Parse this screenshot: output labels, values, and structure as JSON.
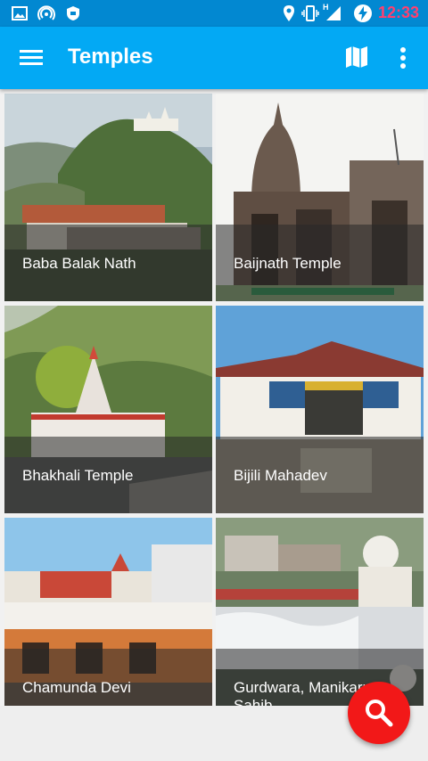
{
  "status_bar": {
    "time": "12:33",
    "icons": [
      "image-icon",
      "hotspot-icon",
      "shield-icon",
      "location-icon",
      "vibrate-icon",
      "signal-icon",
      "battery-charging-icon"
    ],
    "network_label": "H"
  },
  "app_bar": {
    "title": "Temples",
    "menu_icon": "menu-icon",
    "map_icon": "map-icon",
    "more_icon": "more-vert-icon",
    "color": "#03a9f4"
  },
  "temples": [
    {
      "name": "Baba Balak Nath"
    },
    {
      "name": "Baijnath Temple"
    },
    {
      "name": "Bhakhali Temple"
    },
    {
      "name": "Bijili Mahadev"
    },
    {
      "name": "Chamunda Devi"
    },
    {
      "name": "Gurdwara, Manikarna Sahib"
    }
  ],
  "fab": {
    "icon": "search-icon",
    "color": "#f21818"
  }
}
